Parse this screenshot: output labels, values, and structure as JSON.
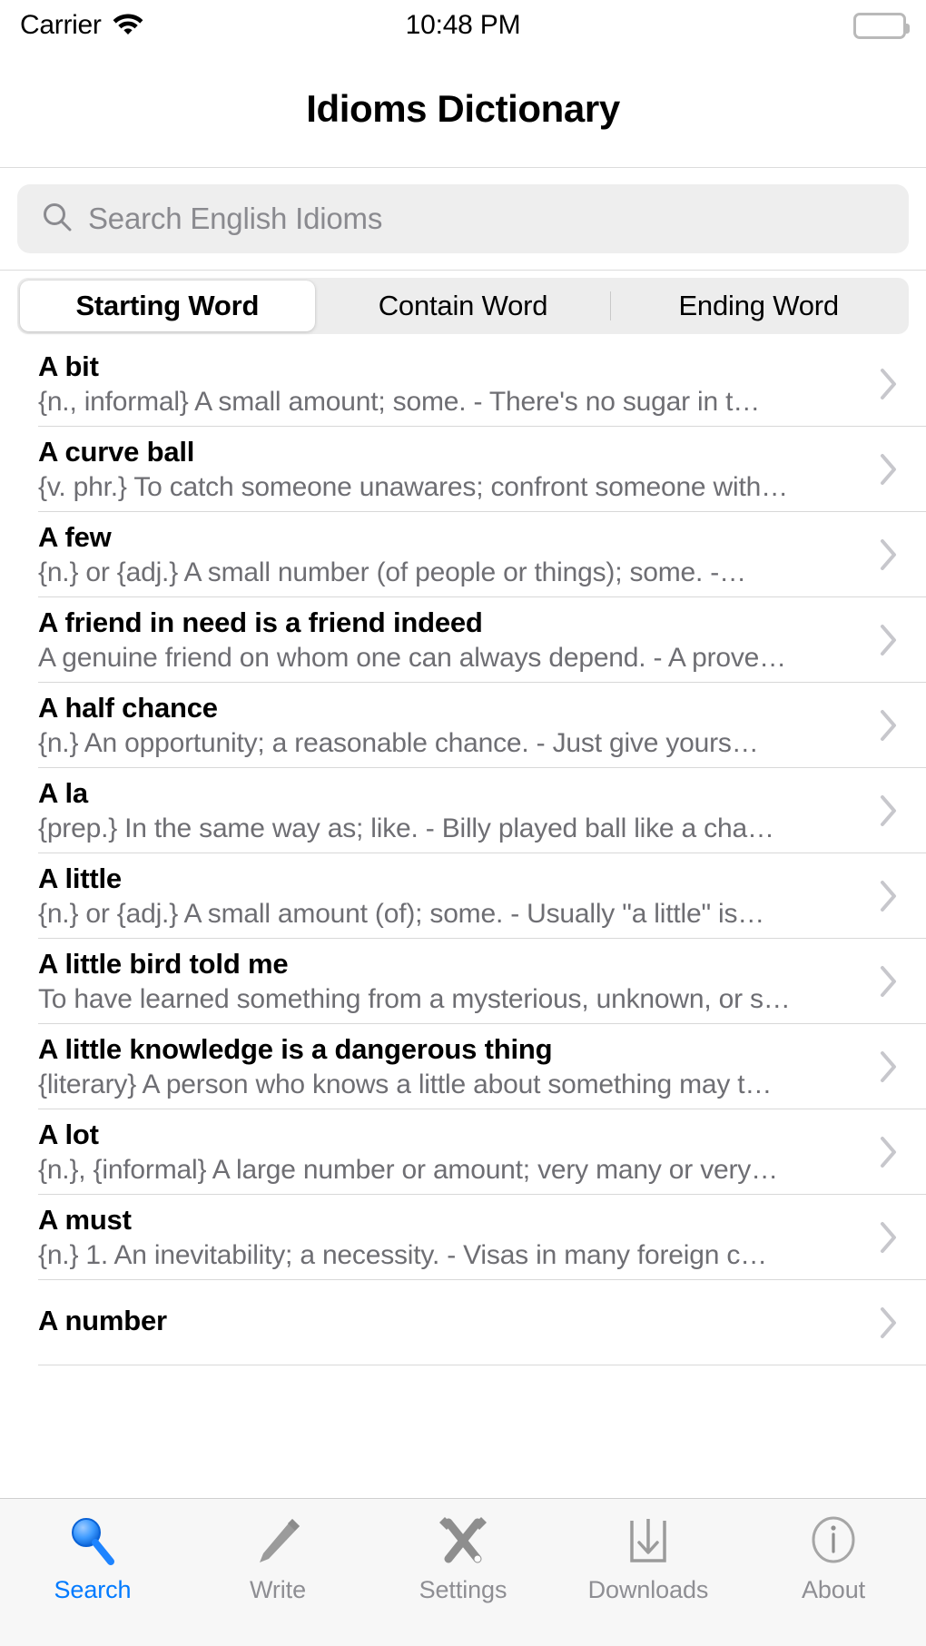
{
  "status_bar": {
    "carrier": "Carrier",
    "wifi_icon": "wifi-icon",
    "time": "10:48 PM",
    "battery_icon": "battery-full-icon"
  },
  "nav": {
    "title": "Idioms Dictionary"
  },
  "search": {
    "icon": "search-icon",
    "placeholder": "Search English Idioms",
    "value": ""
  },
  "segmented_control": {
    "selected_index": 0,
    "options": [
      {
        "label": "Starting Word"
      },
      {
        "label": "Contain Word"
      },
      {
        "label": "Ending Word"
      }
    ]
  },
  "list": {
    "disclosure_icon": "chevron-right-icon",
    "rows": [
      {
        "title": "A bit",
        "subtitle": "{n., informal} A small amount; some.   -  There's no sugar in t…"
      },
      {
        "title": "A curve ball",
        "subtitle": "{v. phr.} To catch someone unawares; confront someone with…"
      },
      {
        "title": "A few",
        "subtitle": "{n.} or {adj.} A small number (of people or things); some.   -…"
      },
      {
        "title": "A friend in need is a friend indeed",
        "subtitle": "A genuine friend on whom one can always depend. - A prove…"
      },
      {
        "title": "A half chance",
        "subtitle": "{n.} An opportunity; a reasonable chance.   -  Just give yours…"
      },
      {
        "title": "A la",
        "subtitle": "{prep.} In the same way as; like.   -  Billy played ball like a cha…"
      },
      {
        "title": "A little",
        "subtitle": "{n.} or {adj.} A small amount (of); some. - Usually \"a little\" is…"
      },
      {
        "title": "A little bird told me",
        "subtitle": "To have learned something from a mysterious, unknown, or s…"
      },
      {
        "title": "A little knowledge is a dangerous thing",
        "subtitle": "{literary} A person who knows a little about something may t…"
      },
      {
        "title": "A lot",
        "subtitle": "{n.}, {informal} A large number or amount; very many or very…"
      },
      {
        "title": "A must",
        "subtitle": "{n.} 1. An inevitability; a necessity.   -  Visas in many foreign c…"
      },
      {
        "title": "A number",
        "subtitle": ""
      }
    ]
  },
  "tab_bar": {
    "active_index": 0,
    "active_color": "#007aff",
    "inactive_color": "#8e8e93",
    "items": [
      {
        "label": "Search",
        "icon": "magnifier-icon"
      },
      {
        "label": "Write",
        "icon": "pencil-icon"
      },
      {
        "label": "Settings",
        "icon": "tools-icon"
      },
      {
        "label": "Downloads",
        "icon": "download-box-icon"
      },
      {
        "label": "About",
        "icon": "info-circle-icon"
      }
    ]
  }
}
